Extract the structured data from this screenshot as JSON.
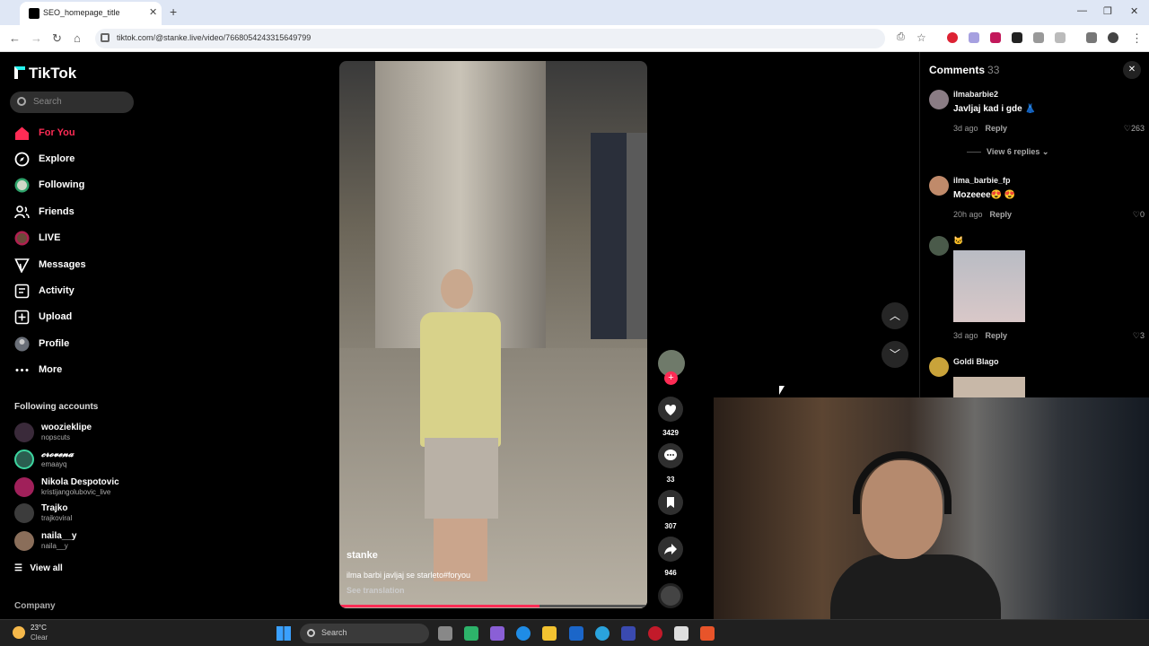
{
  "browser": {
    "tab_title": "SEO_homepage_title",
    "url": "tiktok.com/@stanke.live/video/7668054243315649799"
  },
  "sidebar": {
    "logo": "TikTok",
    "search_placeholder": "Search",
    "nav": [
      {
        "label": "For You",
        "icon": "home-icon",
        "active": true
      },
      {
        "label": "Explore",
        "icon": "compass-icon"
      },
      {
        "label": "Following",
        "icon": "following-avatar-icon"
      },
      {
        "label": "Friends",
        "icon": "friends-icon"
      },
      {
        "label": "LIVE",
        "icon": "live-icon"
      },
      {
        "label": "Messages",
        "icon": "messages-icon"
      },
      {
        "label": "Activity",
        "icon": "activity-icon"
      },
      {
        "label": "Upload",
        "icon": "upload-icon"
      },
      {
        "label": "Profile",
        "icon": "profile-avatar-icon"
      },
      {
        "label": "More",
        "icon": "more-icon"
      }
    ],
    "following_heading": "Following accounts",
    "accounts": [
      {
        "name": "woozieklipe r",
        "display": "woozieklipe",
        "handle": "nopscuts"
      },
      {
        "name": "𝓬𝓻𝓸𝓿𝓮𝓷𝓪",
        "handle": "emaayq"
      },
      {
        "name": "Nikola Despotovic",
        "handle": "kristijangolubovic_live"
      },
      {
        "name": "Trajko",
        "handle": "trajkoviral"
      },
      {
        "name": "naila__y",
        "handle": "naila__y"
      }
    ],
    "view_all": "View all",
    "company": "Company"
  },
  "video": {
    "author": "stanke",
    "caption": "ilma barbi javljaj se starleto#foryou",
    "see_translation": "See translation",
    "progress": 0.65
  },
  "actions": {
    "likes": "3429",
    "comments": "33",
    "saves": "307",
    "shares": "946"
  },
  "comments": {
    "title": "Comments",
    "count": "33",
    "items": [
      {
        "user": "ilmabarbie2",
        "text": "Javljaj kad i gde 👗",
        "time": "3d ago",
        "reply": "Reply",
        "likes": "263",
        "view_replies": "View 6 replies"
      },
      {
        "user": "ilma_barbie_fp",
        "text": "Mozeeee😍 😍",
        "time": "20h ago",
        "reply": "Reply",
        "likes": "0"
      },
      {
        "user": "🐱",
        "text": "",
        "time": "3d ago",
        "reply": "Reply",
        "likes": "3"
      },
      {
        "user": "Goldi Blago",
        "text": ""
      }
    ]
  },
  "taskbar": {
    "temp": "23°C",
    "condition": "Clear",
    "search": "Search"
  },
  "colors": {
    "accent": "#fe2c55",
    "bg": "#000000"
  }
}
